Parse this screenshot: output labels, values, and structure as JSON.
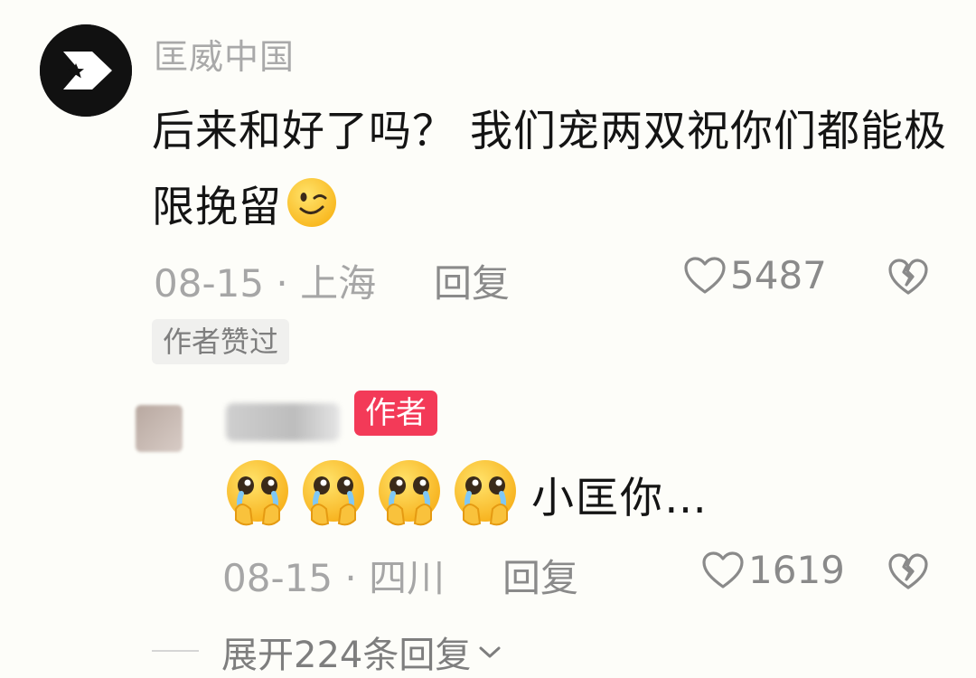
{
  "comment": {
    "username": "匡威中国",
    "text": "后来和好了吗？ 我们宠两双祝你们都能极限挽留",
    "emoji": "wink-face-icon",
    "date": "08-15 · 上海",
    "reply_label": "回复",
    "likes": "5487",
    "author_liked": "作者赞过"
  },
  "reply": {
    "author_badge": "作者",
    "emojis": [
      "pleading-face-icon",
      "pleading-face-icon",
      "pleading-face-icon",
      "pleading-face-icon"
    ],
    "text": "小匡你…",
    "date": "08-15 · 四川",
    "reply_label": "回复",
    "likes": "1619"
  },
  "expand": {
    "label": "展开224条回复"
  },
  "colors": {
    "background": "#fdfdf9",
    "badge": "#f33a58",
    "meta": "#a6a6a6"
  }
}
